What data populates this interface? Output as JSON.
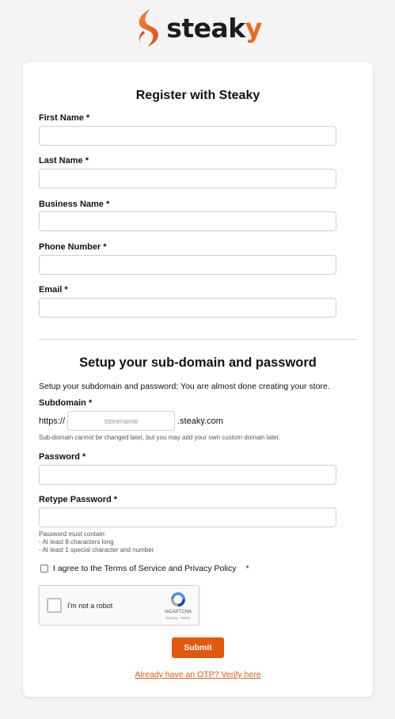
{
  "brand": {
    "name_main": "steak",
    "name_accent": "y",
    "logo_icon": "flame-s-logo-icon",
    "colors": {
      "primary": "#e2580c",
      "logo_gradient_from": "#ef7b2f",
      "logo_gradient_to": "#e0471b"
    }
  },
  "form": {
    "title": "Register with Steaky",
    "fields": {
      "first_name": {
        "label": "First Name *",
        "value": "",
        "placeholder": ""
      },
      "last_name": {
        "label": "Last Name *",
        "value": "",
        "placeholder": ""
      },
      "business_name": {
        "label": "Business Name *",
        "value": "",
        "placeholder": ""
      },
      "phone_number": {
        "label": "Phone Number *",
        "value": "",
        "placeholder": ""
      },
      "email": {
        "label": "Email *",
        "value": "",
        "placeholder": ""
      }
    }
  },
  "setup": {
    "title": "Setup your sub-domain and password",
    "description": "Setup your subdomain and password; You are almost done creating your store.",
    "subdomain": {
      "label": "Subdomain *",
      "prefix": "https://",
      "placeholder": "storename",
      "value": "",
      "suffix": ".steaky.com",
      "help": "Sub-domain cannot be changed later, but you may add your own custom domain later."
    },
    "password": {
      "label": "Password *",
      "value": ""
    },
    "retype_password": {
      "label": "Retype Password *",
      "value": ""
    },
    "password_rules": {
      "heading": "Password must contain:",
      "rules": [
        "- At least 8 characters long",
        "- At least 1 special character and number"
      ]
    },
    "terms": {
      "label": "I agree to the Terms of Service and Privacy Policy",
      "required_mark": "*",
      "checked": false
    },
    "recaptcha": {
      "label": "I'm not a robot",
      "brand": "reCAPTCHA",
      "links": "Privacy - Terms",
      "icon": "recaptcha-icon"
    },
    "submit_label": "Submit",
    "otp_link": "Already have an OTP? Verify here"
  }
}
